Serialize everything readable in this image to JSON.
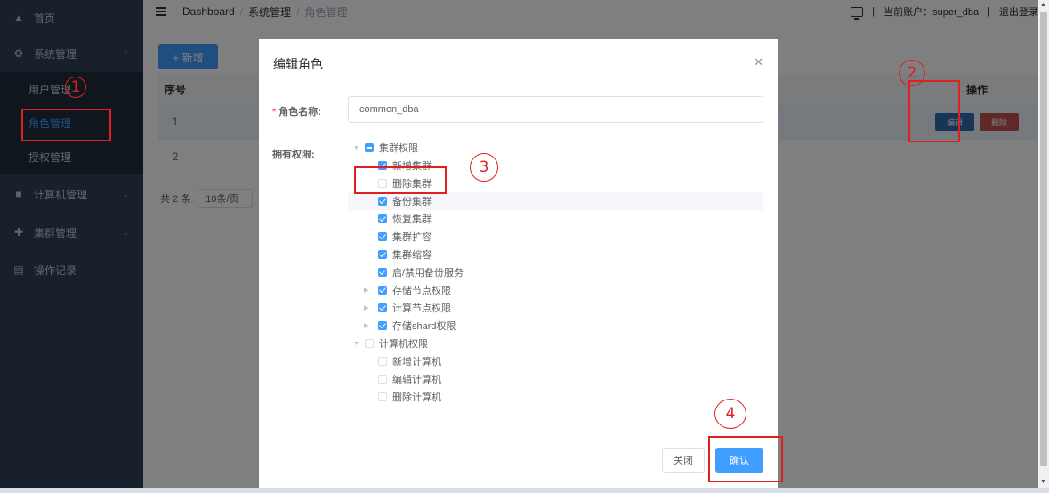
{
  "sidebar": {
    "home": "首页",
    "system": "系统管理",
    "sub_items": [
      "用户管理",
      "角色管理",
      "授权管理"
    ],
    "computer": "计算机管理",
    "cluster": "集群管理",
    "oplog": "操作记录"
  },
  "header": {
    "breadcrumb": [
      "Dashboard",
      "系统管理",
      "角色管理"
    ],
    "account": "当前账户：super_dba",
    "logout": "退出登录"
  },
  "main": {
    "add_button": "+ 新增",
    "table": {
      "col_index": "序号",
      "col_ops": "操作",
      "rows": [
        "1",
        "2"
      ],
      "edit_label": "编辑",
      "delete_label": "删除"
    },
    "pager": {
      "total": "共 2 条",
      "page_size": "10条/页"
    }
  },
  "dialog": {
    "title": "编辑角色",
    "role_name_label": "角色名称:",
    "role_name_value": "common_dba",
    "perm_label": "拥有权限:",
    "tree": [
      {
        "label": "集群权限",
        "state": "indeterminate",
        "level": 0,
        "caret": "open"
      },
      {
        "label": "新增集群",
        "state": "checked",
        "level": 1,
        "caret": ""
      },
      {
        "label": "删除集群",
        "state": "unchecked",
        "level": 1,
        "caret": ""
      },
      {
        "label": "备份集群",
        "state": "checked",
        "level": 1,
        "caret": ""
      },
      {
        "label": "恢复集群",
        "state": "checked",
        "level": 1,
        "caret": ""
      },
      {
        "label": "集群扩容",
        "state": "checked",
        "level": 1,
        "caret": ""
      },
      {
        "label": "集群缩容",
        "state": "checked",
        "level": 1,
        "caret": ""
      },
      {
        "label": "启/禁用备份服务",
        "state": "checked",
        "level": 1,
        "caret": ""
      },
      {
        "label": "存储节点权限",
        "state": "checked",
        "level": 1,
        "caret": "closed"
      },
      {
        "label": "计算节点权限",
        "state": "checked",
        "level": 1,
        "caret": "closed"
      },
      {
        "label": "存储shard权限",
        "state": "checked",
        "level": 1,
        "caret": "closed"
      },
      {
        "label": "计算机权限",
        "state": "unchecked",
        "level": 0,
        "caret": "open"
      },
      {
        "label": "新增计算机",
        "state": "unchecked",
        "level": 1,
        "caret": ""
      },
      {
        "label": "编辑计算机",
        "state": "unchecked",
        "level": 1,
        "caret": ""
      },
      {
        "label": "删除计算机",
        "state": "unchecked",
        "level": 1,
        "caret": ""
      }
    ],
    "close_button": "关闭",
    "confirm_button": "确认"
  },
  "annotations": [
    "1",
    "2",
    "3",
    "4"
  ],
  "colors": {
    "accent": "#409eff",
    "sidebar": "#304156",
    "annotation": "#e02020"
  }
}
